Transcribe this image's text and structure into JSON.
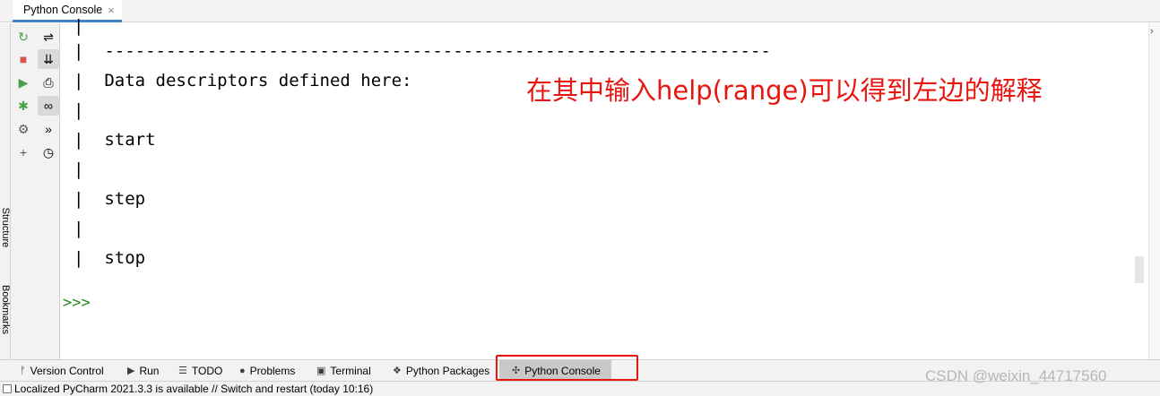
{
  "tab": {
    "title": "Python Console",
    "close": "×"
  },
  "left_stripe": {
    "structure_label": "Structure",
    "bookmarks_label": "Bookmarks"
  },
  "toolbar1": {
    "icons": [
      "rerun-icon",
      "stop-icon",
      "run-icon",
      "debug-icon",
      "settings-icon",
      "add-icon"
    ],
    "glyphs": [
      "↻",
      "■",
      "▶",
      "✱",
      "⚙",
      "+"
    ],
    "colors": [
      "#4aa04a",
      "#d9534f",
      "#4aa04a",
      "#4aa04a",
      "#555555",
      "#555555"
    ]
  },
  "toolbar2": {
    "icons": [
      "soft-wrap-icon",
      "scroll-to-end-icon",
      "print-icon",
      "show-variables-icon",
      "execute-icon",
      "history-icon"
    ],
    "glyphs": [
      "⇌",
      "⇊",
      "⎙",
      "∞",
      "»",
      "◷"
    ]
  },
  "console": {
    "lines": [
      "|",
      "|  -----------------------------------------------------------------",
      "|  Data descriptors defined here:",
      "|",
      "|  start",
      "|",
      "|  step",
      "|",
      "|  stop"
    ],
    "prompt": ">>>",
    "annotation": "在其中输入help(range)可以得到左边的解释"
  },
  "scrollbar": {
    "collapse": "›"
  },
  "bottom_bar": {
    "items": [
      {
        "label": "Version Control",
        "icon": "ᚠ"
      },
      {
        "label": "Run",
        "icon": "▶"
      },
      {
        "label": "TODO",
        "icon": "☰"
      },
      {
        "label": "Problems",
        "icon": "●"
      },
      {
        "label": "Terminal",
        "icon": "▣"
      },
      {
        "label": "Python Packages",
        "icon": "❖"
      },
      {
        "label": "Python Console",
        "icon": "✣"
      }
    ]
  },
  "status": {
    "message": "Localized PyCharm 2021.3.3 is available // Switch and restart (today 10:16)"
  },
  "watermark": "CSDN @weixin_44717560",
  "colors": {
    "accent": "#4083c9",
    "annotation_red": "#e8160f",
    "prompt_green": "#1c8b1c"
  }
}
